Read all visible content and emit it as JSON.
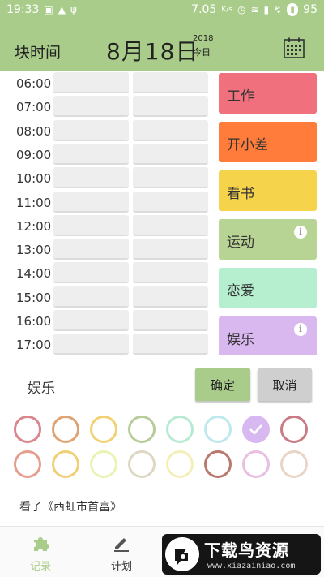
{
  "status_bar": {
    "time": "19:33",
    "speed": "7.05",
    "speed_unit": "K/s",
    "battery": "95"
  },
  "header": {
    "app_title": "块时间",
    "date": "8月18日",
    "year": "2018",
    "today": "今日",
    "accent_color": "#a9cc8a"
  },
  "times": [
    "06:00",
    "07:00",
    "08:00",
    "09:00",
    "10:00",
    "11:00",
    "12:00",
    "13:00",
    "14:00",
    "15:00",
    "16:00",
    "17:00"
  ],
  "categories": [
    {
      "label": "工作",
      "color": "#f0707d",
      "info": false
    },
    {
      "label": "开小差",
      "color": "#ff7c3a",
      "info": false
    },
    {
      "label": "看书",
      "color": "#f5d44c",
      "info": false
    },
    {
      "label": "运动",
      "color": "#b7d494",
      "info": true
    },
    {
      "label": "恋爱",
      "color": "#b5efcf",
      "info": false
    },
    {
      "label": "娱乐",
      "color": "#d9b8f0",
      "info": true
    }
  ],
  "selection": {
    "name": "娱乐",
    "ok_label": "确定",
    "cancel_label": "取消"
  },
  "palette": {
    "row1": [
      "#d9868d",
      "#e0a474",
      "#f0d273",
      "#b8cc9a",
      "#b7ead3",
      "#bde9ee",
      "checked",
      "#c97b86"
    ],
    "row2": [
      "#e59e8e",
      "#f1cf76",
      "#eaf2b4",
      "#ddd7c4",
      "#f2f0b8",
      "#b9796e",
      "#e8bfe0",
      "#e9d5c8"
    ],
    "checked_color": "#d8b8f0"
  },
  "note": "看了《西虹市首富》",
  "bottom_nav": {
    "record_label": "记录",
    "plan_label": "计划"
  },
  "watermark": {
    "title": "下载鸟资源",
    "url": "www.xiazainiao.com"
  }
}
